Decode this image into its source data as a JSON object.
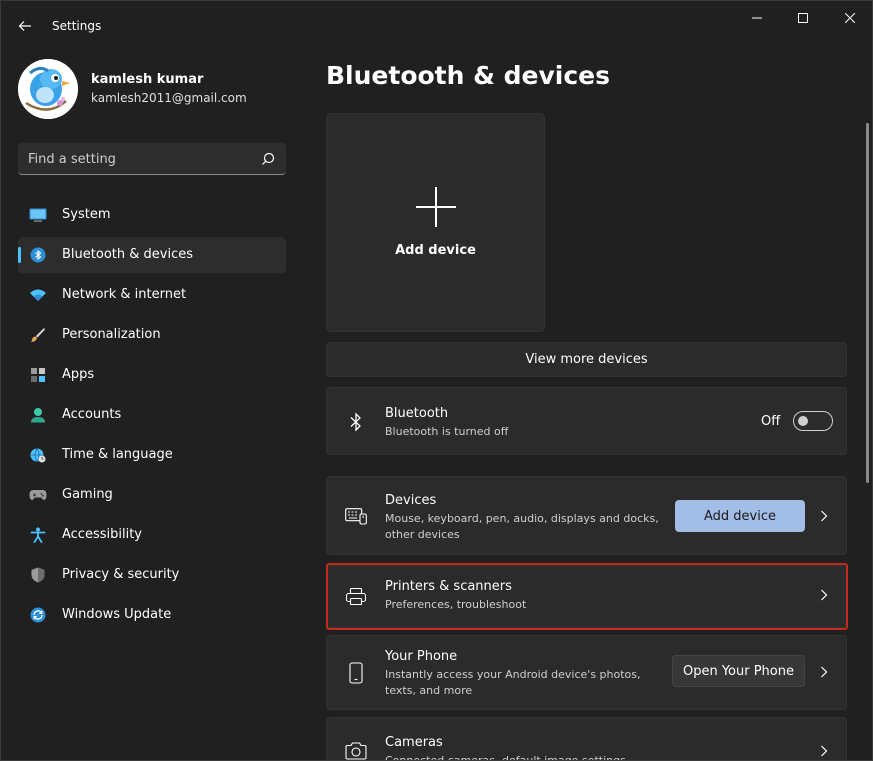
{
  "window": {
    "title": "Settings"
  },
  "profile": {
    "name": "kamlesh kumar",
    "email": "kamlesh2011@gmail.com"
  },
  "search": {
    "placeholder": "Find a setting"
  },
  "sidebar": {
    "items": [
      {
        "label": "System",
        "icon": "monitor-icon",
        "active": false
      },
      {
        "label": "Bluetooth & devices",
        "icon": "bluetooth-icon",
        "active": true
      },
      {
        "label": "Network & internet",
        "icon": "wifi-icon",
        "active": false
      },
      {
        "label": "Personalization",
        "icon": "brush-icon",
        "active": false
      },
      {
        "label": "Apps",
        "icon": "apps-icon",
        "active": false
      },
      {
        "label": "Accounts",
        "icon": "person-icon",
        "active": false
      },
      {
        "label": "Time & language",
        "icon": "globe-clock-icon",
        "active": false
      },
      {
        "label": "Gaming",
        "icon": "gamepad-icon",
        "active": false
      },
      {
        "label": "Accessibility",
        "icon": "accessibility-icon",
        "active": false
      },
      {
        "label": "Privacy & security",
        "icon": "shield-icon",
        "active": false
      },
      {
        "label": "Windows Update",
        "icon": "update-icon",
        "active": false
      }
    ]
  },
  "main": {
    "title": "Bluetooth & devices",
    "add_tile_label": "Add device",
    "view_more_label": "View more devices",
    "bluetooth": {
      "title": "Bluetooth",
      "subtitle": "Bluetooth is turned off",
      "toggle_label": "Off",
      "on": false
    },
    "devices": {
      "title": "Devices",
      "subtitle": "Mouse, keyboard, pen, audio, displays and docks, other devices",
      "button_label": "Add device"
    },
    "printers": {
      "title": "Printers & scanners",
      "subtitle": "Preferences, troubleshoot"
    },
    "phone": {
      "title": "Your Phone",
      "subtitle": "Instantly access your Android device's photos, texts, and more",
      "button_label": "Open Your Phone"
    },
    "cameras": {
      "title": "Cameras",
      "subtitle": "Connected cameras, default image settings"
    }
  },
  "colors": {
    "background": "#202020",
    "card": "#2b2b2b",
    "accent": "#4cc2ff",
    "accent_button": "#a2bde6",
    "highlight": "#c42b1c"
  }
}
